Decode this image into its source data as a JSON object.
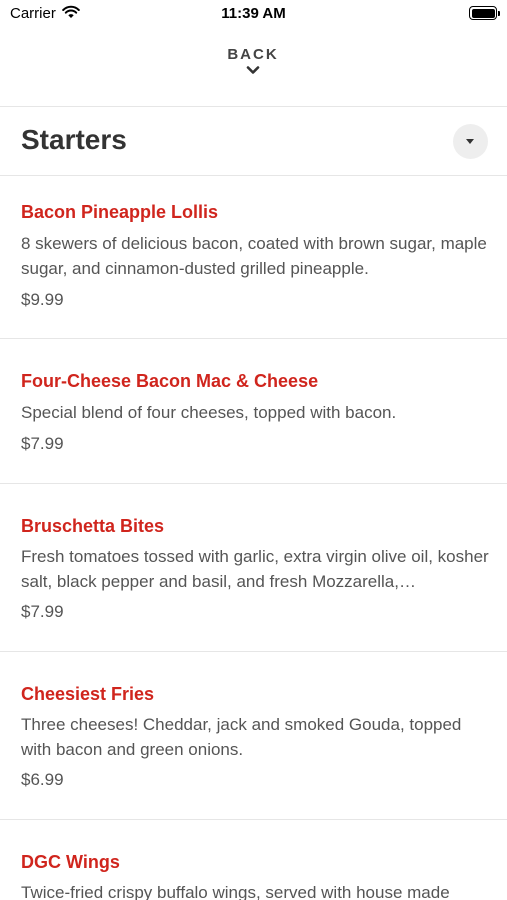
{
  "status_bar": {
    "carrier": "Carrier",
    "time": "11:39 AM",
    "wifi_icon": "wifi-icon",
    "battery_icon": "battery-icon"
  },
  "nav": {
    "back_label": "BACK",
    "back_icon": "chevron-down-icon"
  },
  "section": {
    "title": "Starters",
    "dropdown_icon": "caret-down-icon"
  },
  "colors": {
    "item_name": "#d0251d",
    "text": "#555555",
    "divider": "#e6e6e6"
  },
  "menu_items": [
    {
      "name": "Bacon Pineapple Lollis",
      "description": "8 skewers of delicious bacon, coated with brown sugar, maple sugar, and cinnamon-dusted grilled pineapple.",
      "price": "$9.99"
    },
    {
      "name": "Four-Cheese Bacon Mac & Cheese",
      "description": "Special blend of four cheeses, topped with bacon.",
      "price": "$7.99"
    },
    {
      "name": "Bruschetta Bites",
      "description": "Fresh tomatoes tossed with garlic, extra virgin olive oil, kosher salt, black pepper and basil, and fresh Mozzarella,…",
      "price": "$7.99"
    },
    {
      "name": "Cheesiest Fries",
      "description": "Three cheeses! Cheddar, jack and smoked Gouda, topped with bacon and green onions.",
      "price": "$6.99"
    },
    {
      "name": "DGC Wings",
      "description": "Twice-fried crispy buffalo wings, served with house made",
      "price": ""
    }
  ]
}
